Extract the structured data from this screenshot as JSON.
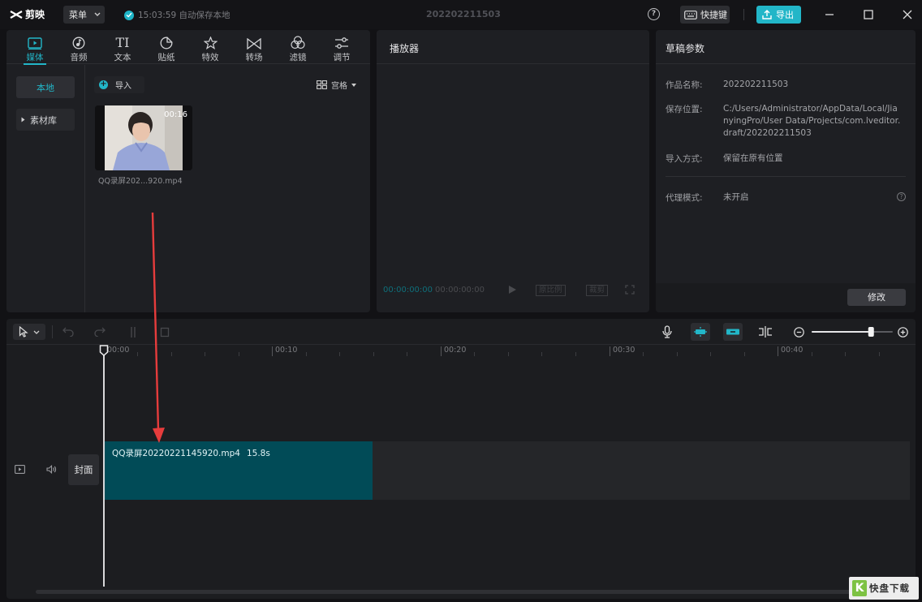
{
  "app": {
    "name": "剪映",
    "menu_label": "菜单",
    "autosave_text": "15:03:59 自动保存本地",
    "doc_title": "202202211503",
    "help_symbol": "?",
    "shortcut_label": "快捷键",
    "export_label": "导出",
    "accent_color": "#22b6c8"
  },
  "media": {
    "tabs": [
      {
        "label": "媒体",
        "icon": "media-icon",
        "active": true
      },
      {
        "label": "音频",
        "icon": "audio-icon"
      },
      {
        "label": "文本",
        "icon": "text-icon",
        "glyph": "TI"
      },
      {
        "label": "贴纸",
        "icon": "sticker-icon"
      },
      {
        "label": "特效",
        "icon": "effects-icon"
      },
      {
        "label": "转场",
        "icon": "transition-icon"
      },
      {
        "label": "滤镜",
        "icon": "filter-icon"
      },
      {
        "label": "调节",
        "icon": "adjust-icon"
      }
    ],
    "sidebar": {
      "local": "本地",
      "library": "素材库"
    },
    "import_label": "导入",
    "view_mode": "宫格",
    "items": [
      {
        "duration": "00:16",
        "name": "QQ录屏202...920.mp4"
      }
    ]
  },
  "player": {
    "title": "播放器",
    "time_current": "00:00:00:00",
    "time_total": "00:00:00:00",
    "btn_ratio": "原比例",
    "btn_crop": "裁剪"
  },
  "params": {
    "title": "草稿参数",
    "rows": [
      {
        "key": "作品名称:",
        "value": "202202211503"
      },
      {
        "key": "保存位置:",
        "value_lines": [
          "C:/Users/Administrator/AppData/Local/Jia",
          "nyingPro/User Data/Projects/com.lveditor.",
          "draft/202202211503"
        ]
      },
      {
        "key": "导入方式:",
        "value": "保留在原有位置"
      },
      {
        "key": "代理模式:",
        "value": "未开启"
      }
    ],
    "help_symbol": "?",
    "modify_label": "修改"
  },
  "timeline": {
    "ruler_labels": [
      "00:00",
      "00:10",
      "00:20",
      "00:30",
      "00:40"
    ],
    "clip": {
      "name": "QQ录屏20220221145920.mp4",
      "duration": "15.8s"
    },
    "cover_label": "封面",
    "zoom_level": 0.75
  },
  "watermark": {
    "mark": "K",
    "text": "快盘下载"
  }
}
